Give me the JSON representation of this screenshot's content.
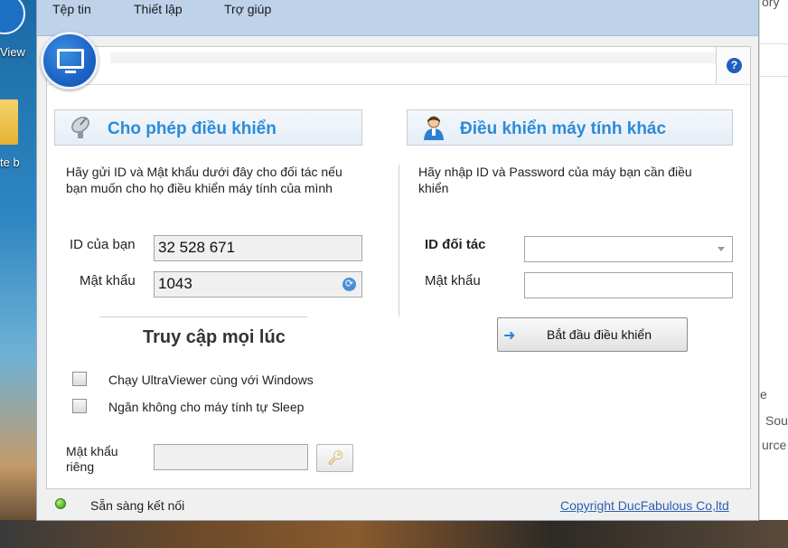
{
  "desktop": {
    "icon_label_1": "View",
    "icon_label_2": "te b",
    "right_fragments": [
      "ory",
      "e",
      "Sou",
      "urce"
    ]
  },
  "menu": {
    "items": [
      "Tệp tin",
      "Thiết lập",
      "Trợ giúp"
    ]
  },
  "left": {
    "title": "Cho phép điều khiển",
    "description": "Hãy gửi ID và Mật khẩu dưới đây cho đối tác nếu bạn muốn cho họ điều khiển máy tính của mình",
    "id_label": "ID của bạn",
    "id_value": "32 528 671",
    "password_label": "Mật khẩu",
    "password_value": "1043"
  },
  "anytime": {
    "title": "Truy cập mọi lúc",
    "options": [
      {
        "label": "Chạy UltraViewer cùng với Windows",
        "checked": false
      },
      {
        "label": "Ngăn không cho máy tính tự Sleep",
        "checked": false
      }
    ],
    "private_password_label": "Mật khẩu riêng",
    "private_password_value": ""
  },
  "right": {
    "title": "Điều khiển máy tính khác",
    "description": "Hãy nhập ID và Password của máy bạn cần điều khiển",
    "partner_id_label": "ID đối tác",
    "partner_id_value": "",
    "password_label": "Mật khẩu",
    "password_value": "",
    "start_button": "Bắt đầu điều khiển"
  },
  "status": {
    "text": "Sẵn sàng kết nối",
    "indicator_color": "#4fae1a",
    "copyright": "Copyright DucFabulous Co,ltd"
  },
  "help": {
    "icon_text": "?"
  },
  "colors": {
    "accent": "#2c8bd8",
    "menubar": "#bed3ea",
    "link": "#2d5fb0"
  }
}
